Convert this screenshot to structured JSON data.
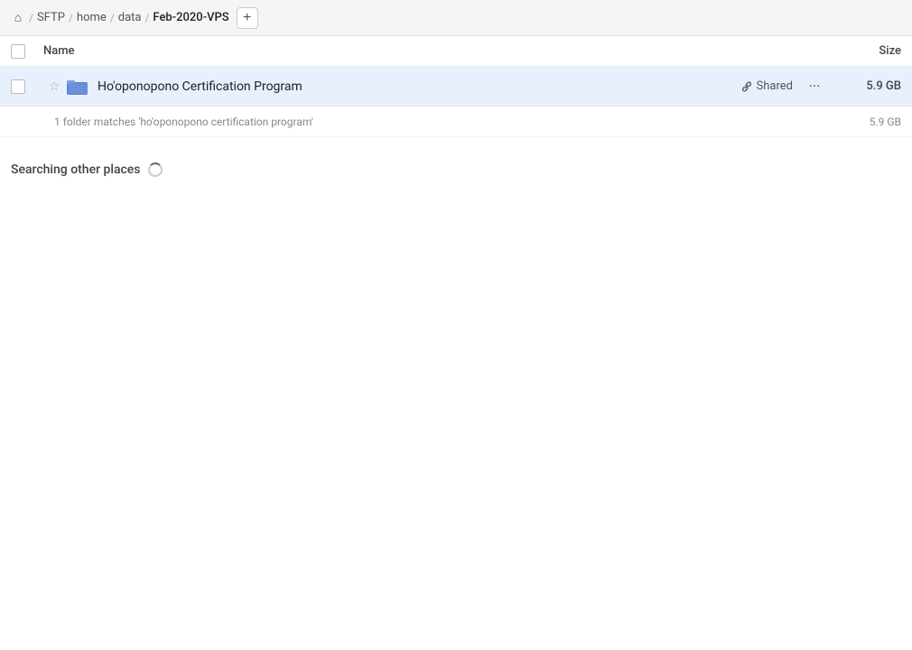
{
  "breadcrumb": {
    "home_icon": "⌂",
    "items": [
      {
        "label": "SFTP",
        "active": false
      },
      {
        "label": "home",
        "active": false
      },
      {
        "label": "data",
        "active": false
      },
      {
        "label": "Feb-2020-VPS",
        "active": true
      }
    ],
    "add_button_label": "+"
  },
  "columns": {
    "name_label": "Name",
    "size_label": "Size"
  },
  "file_row": {
    "name": "Ho'oponopono Certification Program",
    "shared_label": "Shared",
    "size": "5.9 GB",
    "more_icon": "···"
  },
  "match_info": {
    "text": "1 folder matches 'ho'oponopono certification program'",
    "size": "5.9 GB"
  },
  "searching": {
    "label": "Searching other places"
  }
}
